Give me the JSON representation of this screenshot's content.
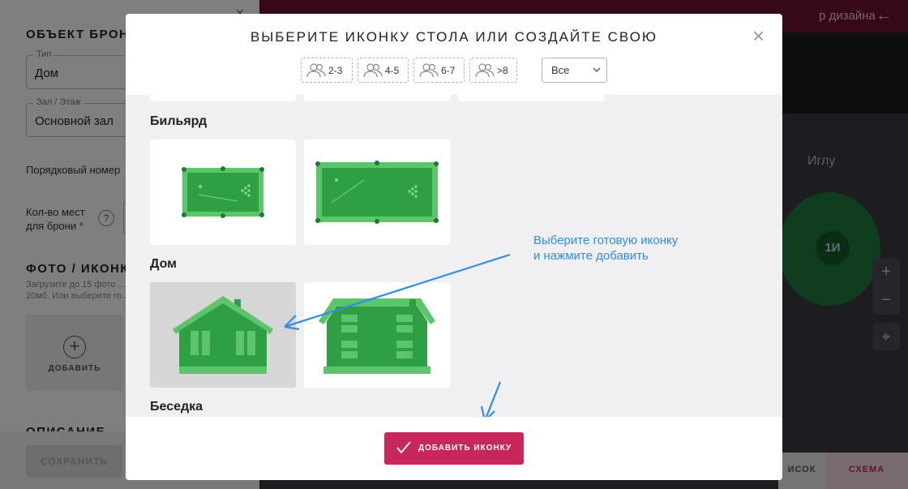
{
  "background": {
    "left_panel": {
      "title": "ОБЪЕКТ БРОНИ",
      "close_icon": "chevron-icon",
      "type_field": {
        "label": "Тип",
        "value": "Дом"
      },
      "hall_field": {
        "label": "Зал / Этаж",
        "value": "Основной зал"
      },
      "order_label": "Порядковый номер",
      "seats_label_line1": "Кол-во мест",
      "seats_label_line2": "для брони",
      "required_mark": "*",
      "help_icon": "?",
      "photos_title": "ФОТО / ИКОНКА",
      "photos_hint_line1": "Загрузите до 15 фото ...",
      "photos_hint_line2": "20мб. Или выберите го...",
      "add_label": "ДОБАВИТЬ",
      "description_title": "ОПИСАНИЕ",
      "save_label": "СОХРАНИТЬ"
    },
    "right_panel": {
      "topbar_text": "р дизайна",
      "back_icon": "←",
      "igloo_label": "Иглу",
      "igloo_table_id": "1И",
      "zoom_in": "+",
      "zoom_out": "−",
      "locate_icon": "⌖",
      "tab_list": "ИСОК",
      "tab_scheme": "СХЕМА"
    }
  },
  "modal": {
    "title": "ВЫБЕРИТЕ ИКОНКУ СТОЛА ИЛИ СОЗДАЙТЕ СВОЮ",
    "close_icon": "×",
    "filters": [
      {
        "label": "2-3",
        "icon": "people-icon"
      },
      {
        "label": "4-5",
        "icon": "people-icon"
      },
      {
        "label": "6-7",
        "icon": "people-icon"
      },
      {
        "label": ">8",
        "icon": "people-icon"
      }
    ],
    "select": {
      "value": "Все",
      "icon": "chevron-down-icon"
    },
    "categories": [
      {
        "label": "Бильярд",
        "icons": [
          "billiard-table-small",
          "billiard-table-large"
        ]
      },
      {
        "label": "Дом",
        "icons": [
          "house-one-storey",
          "house-two-storey"
        ],
        "selected_index": 0
      },
      {
        "label": "Беседка",
        "icons": []
      }
    ],
    "hint_line1": "Выберите готовую иконку",
    "hint_line2": "и нажмите добавить",
    "add_button": "ДОБАВИТЬ ИКОНКУ",
    "colors": {
      "accent": "#c8275c",
      "icon_green": "#2ea043",
      "icon_green_light": "#5cc46a",
      "hint_blue": "#2e8de8"
    }
  }
}
